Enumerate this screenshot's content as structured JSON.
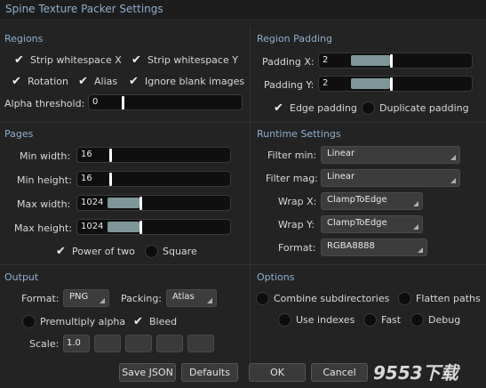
{
  "window": {
    "title": "Spine Texture Packer Settings"
  },
  "regions": {
    "heading": "Regions",
    "strip_x": "Strip whitespace X",
    "strip_y": "Strip whitespace Y",
    "rotation": "Rotation",
    "alias": "Alias",
    "ignore_blank": "Ignore blank images",
    "alpha_label": "Alpha threshold:",
    "alpha_value": "0",
    "alpha_fraction": 0.0
  },
  "padding": {
    "heading": "Region Padding",
    "x_label": "Padding X:",
    "x_value": "2",
    "y_label": "Padding Y:",
    "y_value": "2",
    "edge": "Edge padding",
    "duplicate": "Duplicate padding"
  },
  "pages": {
    "heading": "Pages",
    "min_w_label": "Min width:",
    "min_w": "16",
    "min_h_label": "Min height:",
    "min_h": "16",
    "max_w_label": "Max width:",
    "max_w": "1024",
    "max_h_label": "Max height:",
    "max_h": "1024",
    "power_two": "Power of two",
    "square": "Square"
  },
  "runtime": {
    "heading": "Runtime Settings",
    "filter_min_label": "Filter min:",
    "filter_min": "Linear",
    "filter_mag_label": "Filter mag:",
    "filter_mag": "Linear",
    "wrap_x_label": "Wrap X:",
    "wrap_x": "ClampToEdge",
    "wrap_y_label": "Wrap Y:",
    "wrap_y": "ClampToEdge",
    "format_label": "Format:",
    "format": "RGBA8888"
  },
  "output": {
    "heading": "Output",
    "format_label": "Format:",
    "format": "PNG",
    "packing_label": "Packing:",
    "packing": "Atlas",
    "premultiply": "Premultiply alpha",
    "bleed": "Bleed",
    "scale_label": "Scale:",
    "scale": "1.0"
  },
  "options": {
    "heading": "Options",
    "combine": "Combine subdirectories",
    "flatten": "Flatten paths",
    "indexes": "Use indexes",
    "fast": "Fast",
    "debug": "Debug"
  },
  "footer": {
    "save_json": "Save JSON",
    "defaults": "Defaults",
    "ok": "OK",
    "cancel": "Cancel",
    "watermark": "9553下载"
  },
  "colors": {
    "accent": "#8fb0d0",
    "slider_fill": "#7e9699"
  }
}
